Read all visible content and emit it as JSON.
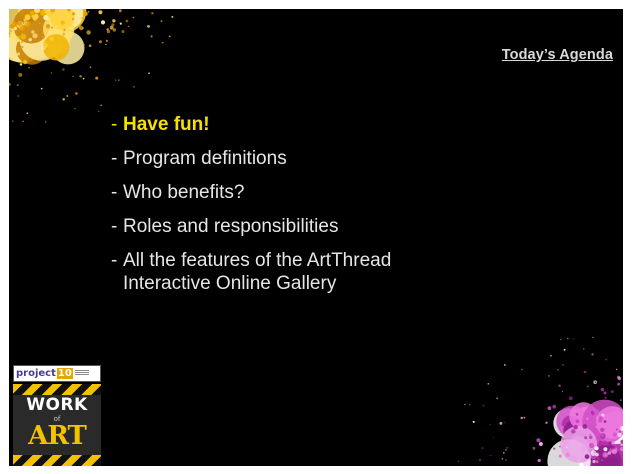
{
  "slide": {
    "title": "Today’s Agenda",
    "items": [
      {
        "dash": "-",
        "text": "Have fun!",
        "highlight": true
      },
      {
        "dash": "-",
        "text": "Program definitions",
        "highlight": false
      },
      {
        "dash": "-",
        "text": "Who benefits?",
        "highlight": false
      },
      {
        "dash": "-",
        "text": "Roles and responsibilities",
        "highlight": false
      },
      {
        "dash": "-",
        "text": "All the features of the ArtThread\nInteractive Online Gallery",
        "highlight": false
      }
    ]
  },
  "logo": {
    "project_prefix": "project",
    "project_number": "10",
    "word_work": "WORK",
    "word_of": "of",
    "word_art": "ART"
  },
  "colors": {
    "background": "#000000",
    "highlight": "#f5e100",
    "text": "#e6e6e6",
    "title": "#d9d9d9",
    "splash_top": "#f0b400",
    "splash_bottom": "#d24fc8"
  },
  "icons": [
    "paint-splash-top-decoration",
    "paint-splash-bottom-decoration",
    "project10-work-of-art-logo"
  ]
}
